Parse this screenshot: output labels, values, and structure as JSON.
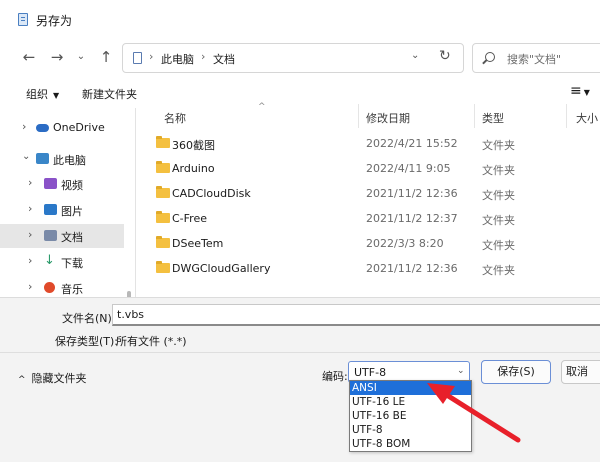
{
  "window": {
    "title": "另存为"
  },
  "address": {
    "crumbs": [
      "此电脑",
      "文档"
    ],
    "separator": "›"
  },
  "search": {
    "placeholder": "搜索\"文档\""
  },
  "toolbar": {
    "organize": "组织",
    "new_folder": "新建文件夹"
  },
  "sidebar": {
    "items": [
      {
        "label": "OneDrive",
        "icon": "cloud-icon",
        "color": "#2b6cc4"
      },
      {
        "label": "此电脑",
        "icon": "computer-icon",
        "color": "#3a86c8"
      },
      {
        "label": "视频",
        "icon": "video-icon",
        "color": "#8a52c8"
      },
      {
        "label": "图片",
        "icon": "pictures-icon",
        "color": "#2a78c8"
      },
      {
        "label": "文档",
        "icon": "documents-icon",
        "color": "#7a8aa8"
      },
      {
        "label": "下载",
        "icon": "download-icon",
        "color": "#2a9a6a"
      },
      {
        "label": "音乐",
        "icon": "music-icon",
        "color": "#e04a2a"
      }
    ]
  },
  "columns": {
    "name": "名称",
    "date": "修改日期",
    "type": "类型",
    "size": "大小"
  },
  "files": [
    {
      "name": "360截图",
      "date": "2022/4/21 15:52",
      "type": "文件夹"
    },
    {
      "name": "Arduino",
      "date": "2022/4/11 9:05",
      "type": "文件夹"
    },
    {
      "name": "CADCloudDisk",
      "date": "2021/11/2 12:36",
      "type": "文件夹"
    },
    {
      "name": "C-Free",
      "date": "2021/11/2 12:37",
      "type": "文件夹"
    },
    {
      "name": "DSeeTem",
      "date": "2022/3/3 8:20",
      "type": "文件夹"
    },
    {
      "name": "DWGCloudGallery",
      "date": "2021/11/2 12:36",
      "type": "文件夹"
    }
  ],
  "save": {
    "filename_label": "文件名(N):",
    "filename_value": "t.vbs",
    "filetype_label": "保存类型(T):",
    "filetype_value": "所有文件 (*.*)",
    "hide_folders": "隐藏文件夹",
    "encoding_label": "编码:",
    "encoding_value": "UTF-8",
    "encoding_options": [
      "ANSI",
      "UTF-16 LE",
      "UTF-16 BE",
      "UTF-8",
      "UTF-8 BOM"
    ],
    "highlighted_option": "ANSI",
    "save_button": "保存(S)",
    "cancel_button": "取消"
  },
  "accent_color": "#1e6fd9",
  "annotation_arrow_color": "#e8202a"
}
